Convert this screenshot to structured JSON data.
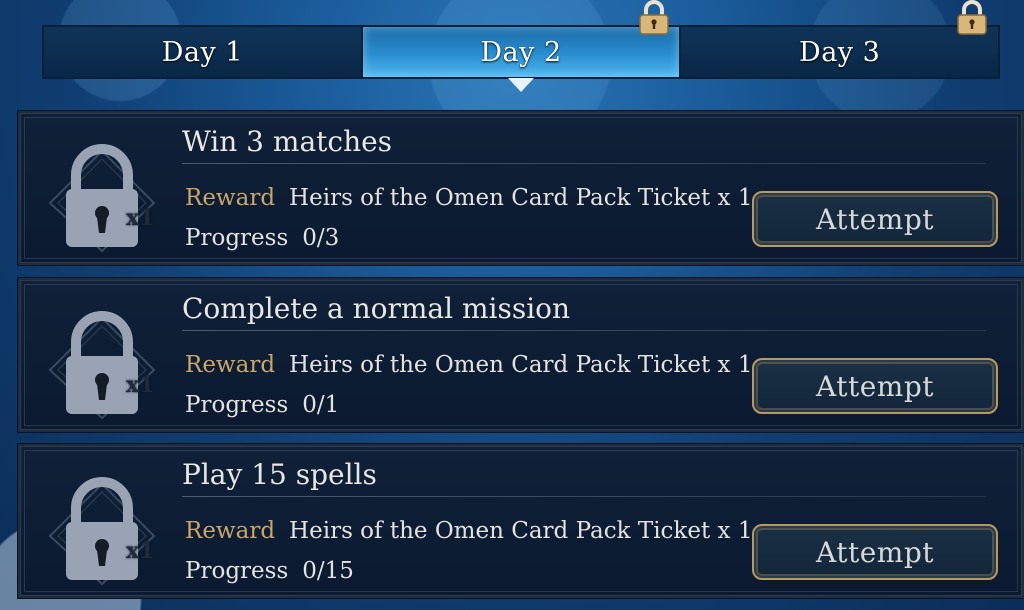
{
  "tabs": [
    {
      "label": "Day 1",
      "active": false,
      "locked": false
    },
    {
      "label": "Day 2",
      "active": true,
      "locked": true
    },
    {
      "label": "Day 3",
      "active": false,
      "locked": true
    }
  ],
  "labels": {
    "reward": "Reward",
    "progress": "Progress"
  },
  "missions": [
    {
      "title": "Win 3 matches",
      "reward": "Heirs of the Omen Card Pack Ticket x 1",
      "progress": "0/3",
      "quantity": "x1",
      "button": "Attempt",
      "icon": "padlock-icon"
    },
    {
      "title": "Complete a normal mission",
      "reward": "Heirs of the Omen Card Pack Ticket x 1",
      "progress": "0/1",
      "quantity": "x1",
      "button": "Attempt",
      "icon": "padlock-icon"
    },
    {
      "title": "Play 15 spells",
      "reward": "Heirs of the Omen Card Pack Ticket x 1",
      "progress": "0/15",
      "quantity": "x1",
      "button": "Attempt",
      "icon": "padlock-icon"
    }
  ],
  "colors": {
    "accent_gold": "#c9a66a",
    "tab_active": "#2a8ed0",
    "panel": "#0b1a30"
  }
}
